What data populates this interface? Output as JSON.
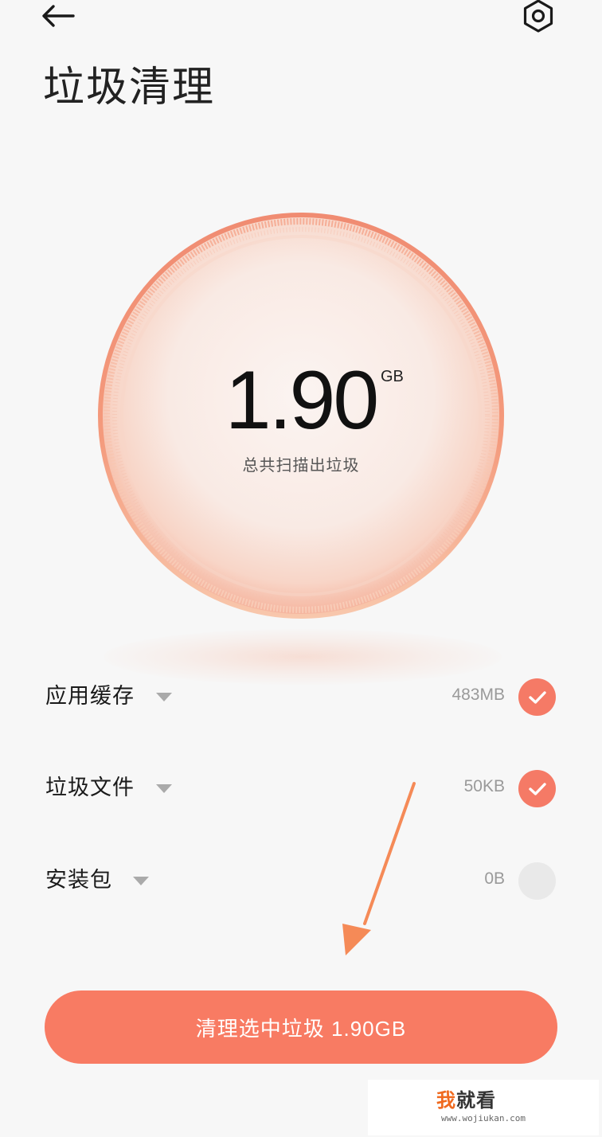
{
  "header": {
    "back_icon": "arrow-left-icon",
    "settings_icon": "hexagon-gear-icon",
    "title": "垃圾清理"
  },
  "scan": {
    "amount": "1.90",
    "unit": "GB",
    "caption": "总共扫描出垃圾"
  },
  "categories": [
    {
      "label": "应用缓存",
      "size": "483MB",
      "checked": true
    },
    {
      "label": "垃圾文件",
      "size": "50KB",
      "checked": true
    },
    {
      "label": "安装包",
      "size": "0B",
      "checked": false
    }
  ],
  "action": {
    "clean_label": "清理选中垃圾 1.90GB"
  },
  "annotation": {
    "arrow_color": "#f58a57",
    "icon": "arrow-pointer-icon"
  },
  "watermark": {
    "title_a": "我",
    "title_b": "就看",
    "url": "www.wojiukan.com"
  },
  "colors": {
    "accent": "#f87b63",
    "check_on": "#f57a66",
    "check_off": "#e9e9e9",
    "background": "#f7f7f7"
  }
}
